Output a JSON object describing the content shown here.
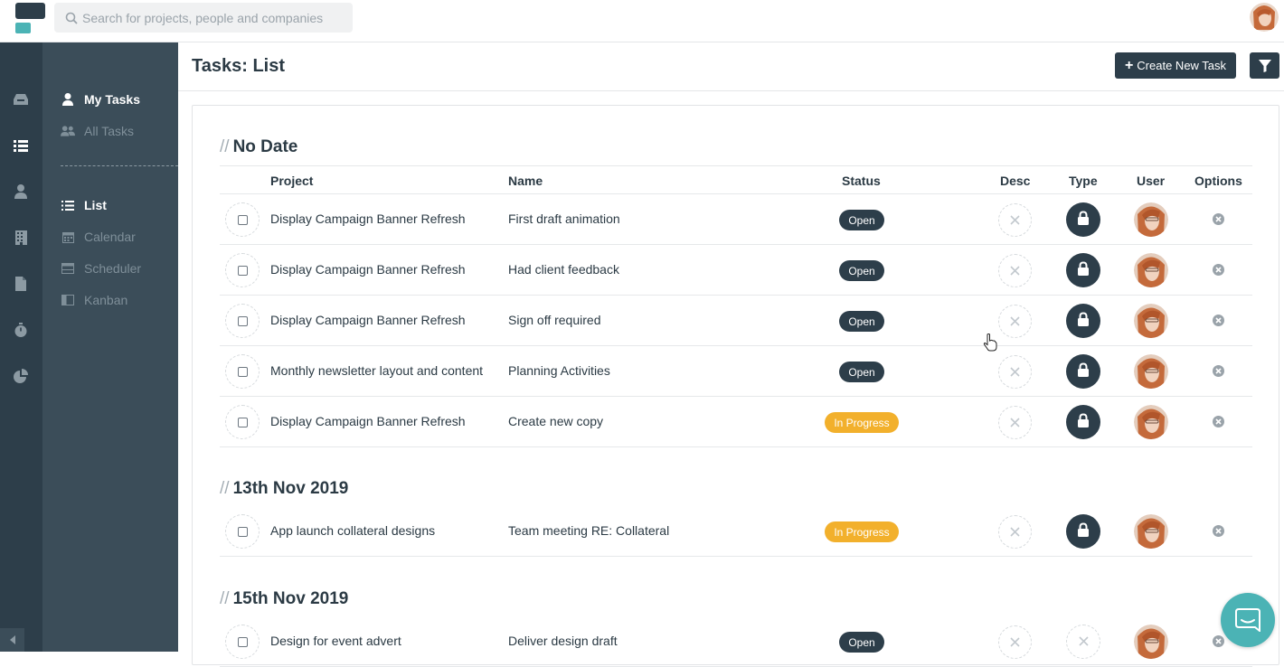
{
  "search": {
    "placeholder": "Search for projects, people and companies"
  },
  "subnav": {
    "my_tasks": "My Tasks",
    "all_tasks": "All Tasks",
    "list": "List",
    "calendar": "Calendar",
    "scheduler": "Scheduler",
    "kanban": "Kanban"
  },
  "header": {
    "title": "Tasks: List",
    "create_label": "Create New Task"
  },
  "columns": {
    "project": "Project",
    "name": "Name",
    "status": "Status",
    "desc": "Desc",
    "type": "Type",
    "user": "User",
    "options": "Options"
  },
  "sections": [
    {
      "title": "No Date",
      "rows": [
        {
          "project": "Display Campaign Banner Refresh",
          "name": "First draft animation",
          "status": "Open"
        },
        {
          "project": "Display Campaign Banner Refresh",
          "name": "Had client feedback",
          "status": "Open"
        },
        {
          "project": "Display Campaign Banner Refresh",
          "name": "Sign off required",
          "status": "Open"
        },
        {
          "project": "Monthly newsletter layout and content",
          "name": "Planning Activities",
          "status": "Open"
        },
        {
          "project": "Display Campaign Banner Refresh",
          "name": "Create new copy",
          "status": "In Progress"
        }
      ]
    },
    {
      "title": "13th Nov 2019",
      "rows": [
        {
          "project": "App launch collateral designs",
          "name": "Team meeting RE: Collateral",
          "status": "In Progress"
        }
      ]
    },
    {
      "title": "15th Nov 2019",
      "rows": [
        {
          "project": "Design for event advert",
          "name": "Deliver design draft",
          "status": "Open"
        }
      ]
    }
  ],
  "colors": {
    "dark": "#2d3e4a",
    "subnav": "#3b4d59",
    "accent": "#4bb3b5",
    "in_progress": "#f2b02c"
  }
}
